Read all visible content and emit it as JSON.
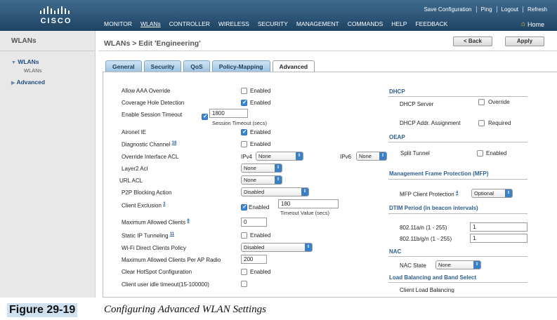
{
  "brand": {
    "wordmark": "CISCO"
  },
  "util_links": [
    "Save Configuration",
    "Ping",
    "Logout",
    "Refresh"
  ],
  "nav": [
    "MONITOR",
    "WLANs",
    "CONTROLLER",
    "WIRELESS",
    "SECURITY",
    "MANAGEMENT",
    "COMMANDS",
    "HELP",
    "FEEDBACK"
  ],
  "home_label": "Home",
  "sidebar": {
    "title": "WLANs",
    "items": [
      {
        "label": "WLANs",
        "child": "WLANs"
      },
      {
        "label": "Advanced"
      }
    ]
  },
  "breadcrumb": "WLANs > Edit  'Engineering'",
  "buttons": {
    "back": "< Back",
    "apply": "Apply"
  },
  "tabs": [
    "General",
    "Security",
    "QoS",
    "Policy-Mapping",
    "Advanced"
  ],
  "active_tab": "Advanced",
  "left": {
    "allow_aaa": {
      "label": "Allow AAA Override",
      "state": "Enabled",
      "checked": false
    },
    "coverage_hole": {
      "label": "Coverage Hole Detection",
      "state": "Enabled",
      "checked": true
    },
    "session_timeout": {
      "label": "Enable Session Timeout",
      "value": "1800",
      "unit": "Session Timeout (secs)",
      "checked": true
    },
    "aironet_ie": {
      "label": "Aironet IE",
      "state": "Enabled",
      "checked": true
    },
    "diag_channel": {
      "label": "Diagnostic Channel",
      "footnote": "18",
      "state": "Enabled",
      "checked": false
    },
    "override_acl": {
      "label": "Override Interface ACL",
      "ipv4_label": "IPv4",
      "ipv4_value": "None",
      "ipv6_label": "IPv6",
      "ipv6_value": "None"
    },
    "layer2_acl": {
      "label": "Layer2 Acl",
      "value": "None"
    },
    "url_acl": {
      "label": "URL ACL",
      "value": "None"
    },
    "p2p": {
      "label": "P2P Blocking Action",
      "value": "Disabled"
    },
    "client_exclusion": {
      "label": "Client Exclusion",
      "footnote": "3",
      "state": "Enabled",
      "checked": true,
      "value": "180",
      "unit": "Timeout Value (secs)"
    },
    "max_clients": {
      "label": "Maximum Allowed Clients",
      "footnote": "8",
      "value": "0"
    },
    "static_ip": {
      "label": "Static IP Tunneling",
      "footnote": "11",
      "state": "Enabled",
      "checked": false
    },
    "wifi_direct": {
      "label": "Wi-Fi Direct Clients Policy",
      "value": "Disabled"
    },
    "max_per_ap": {
      "label": "Maximum Allowed Clients Per AP Radio",
      "value": "200"
    },
    "clear_hotspot": {
      "label": "Clear HotSpot Configuration",
      "state": "Enabled",
      "checked": false
    },
    "idle_timeout": {
      "label": "Client user idle timeout(15-100000)",
      "checked": false
    }
  },
  "right": {
    "dhcp": {
      "title": "DHCP",
      "server_label": "DHCP Server",
      "override": "Override",
      "assign_label": "DHCP Addr. Assignment",
      "required": "Required"
    },
    "oeap": {
      "title": "OEAP",
      "split_label": "Split Tunnel",
      "state": "Enabled"
    },
    "mfp": {
      "title": "Management Frame Protection (MFP)",
      "label": "MFP Client Protection",
      "footnote": "4",
      "value": "Optional"
    },
    "dtim": {
      "title": "DTIM Period (in beacon intervals)",
      "a_label": "802.11a/n (1 - 255)",
      "a_value": "1",
      "b_label": "802.11b/g/n (1 - 255)",
      "b_value": "1"
    },
    "nac": {
      "title": "NAC",
      "label": "NAC State",
      "value": "None"
    },
    "lb": {
      "title": "Load Balancing and Band Select",
      "item": "Client Load Balancing"
    }
  },
  "caption": {
    "label": "Figure 29-19",
    "text": "Configuring Advanced WLAN Settings"
  },
  "colors": {
    "header": "#2b5273",
    "tab": "#aacbe6",
    "checked": "#3a87d6",
    "section": "#2f5e8e"
  }
}
